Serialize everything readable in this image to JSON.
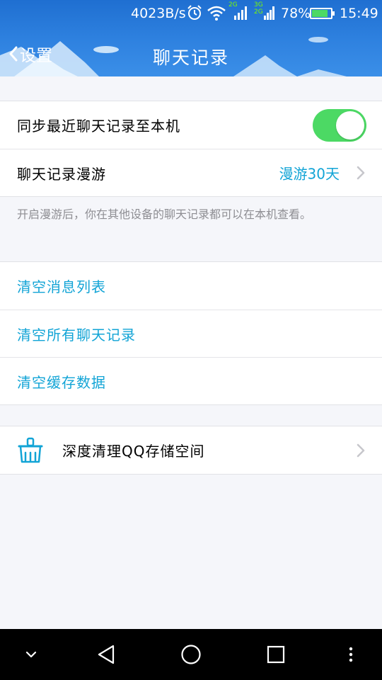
{
  "status_bar": {
    "network_speed": "4023B/s",
    "net_badge_1": "2G",
    "net_badge_2": "3G",
    "net_badge_3": "2G",
    "battery_percent": "78%",
    "time": "15:49"
  },
  "header": {
    "back_label": "设置",
    "title": "聊天记录"
  },
  "sync_group": {
    "sync_label": "同步最近聊天记录至本机",
    "sync_enabled": true,
    "roam_label": "聊天记录漫游",
    "roam_value": "漫游30天"
  },
  "roam_hint": "开启漫游后，你在其他设备的聊天记录都可以在本机查看。",
  "clear_group": {
    "clear_message_list": "清空消息列表",
    "clear_all_chats": "清空所有聊天记录",
    "clear_cache": "清空缓存数据"
  },
  "deep_clean": {
    "label": "深度清理QQ存储空间"
  },
  "colors": {
    "header_blue": "#2f82e0",
    "accent_blue": "#12a4d6",
    "toggle_on": "#4cd964"
  }
}
